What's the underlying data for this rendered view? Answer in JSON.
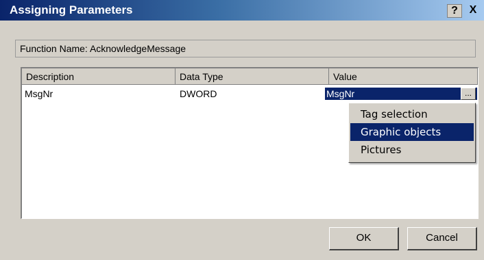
{
  "window": {
    "title": "Assigning Parameters",
    "help_label": "?",
    "close_label": "X"
  },
  "function_name": "Function Name: AcknowledgeMessage",
  "table": {
    "columns": [
      "Description",
      "Data Type",
      "Value"
    ],
    "rows": [
      {
        "description": "MsgNr",
        "data_type": "DWORD",
        "value": "MsgNr"
      }
    ],
    "browse_label": "..."
  },
  "context_menu": {
    "items": [
      "Tag selection",
      "Graphic objects",
      "Pictures"
    ],
    "highlighted": "Graphic objects"
  },
  "buttons": {
    "ok": "OK",
    "cancel": "Cancel"
  },
  "colors": {
    "title_bar_start": "#0a246a",
    "title_bar_end": "#a6caf0",
    "selection": "#0a246a",
    "dialog_face": "#d4d0c8"
  }
}
